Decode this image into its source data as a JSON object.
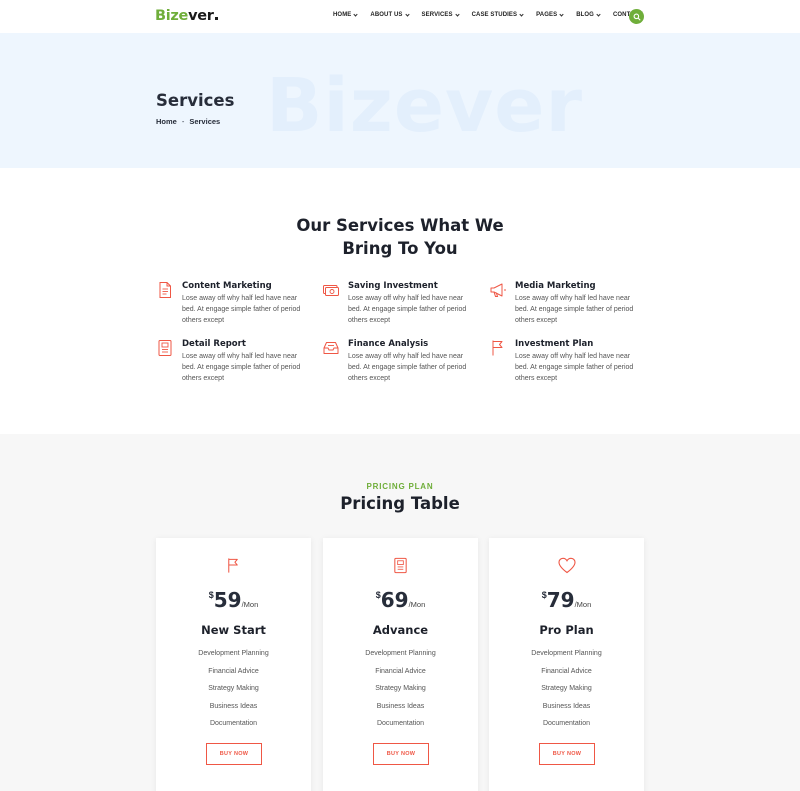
{
  "brand": {
    "logo_green": "Bize",
    "logo_dark": "ver",
    "accent": "#6fae3a",
    "icon_color": "#ef5745"
  },
  "nav": [
    {
      "label": "HOME",
      "dropdown": true
    },
    {
      "label": "ABOUT US",
      "dropdown": true
    },
    {
      "label": "SERVICES",
      "dropdown": true
    },
    {
      "label": "CASE STUDIES",
      "dropdown": true
    },
    {
      "label": "PAGES",
      "dropdown": true
    },
    {
      "label": "BLOG",
      "dropdown": true
    },
    {
      "label": "CONTACT",
      "dropdown": false
    }
  ],
  "search_icon": "search-icon",
  "banner": {
    "watermark": "Bizever",
    "title": "Services",
    "breadcrumb": {
      "home": "Home",
      "separator": "-",
      "current": "Services"
    }
  },
  "services": {
    "heading_line1": "Our Services What We",
    "heading_line2": "Bring To You",
    "items": [
      {
        "icon": "document-icon",
        "title": "Content Marketing",
        "desc": "Lose away off why half led have near bed. At engage simple father of period others except"
      },
      {
        "icon": "money-icon",
        "title": "Saving Investment",
        "desc": "Lose away off why half led have near bed. At engage simple father of period others except"
      },
      {
        "icon": "megaphone-icon",
        "title": "Media Marketing",
        "desc": "Lose away off why half led have near bed. At engage simple father of period others except"
      },
      {
        "icon": "report-icon",
        "title": "Detail Report",
        "desc": "Lose away off why half led have near bed. At engage simple father of period others except"
      },
      {
        "icon": "inbox-icon",
        "title": "Finance Analysis",
        "desc": "Lose away off why half led have near bed. At engage simple father of period others except"
      },
      {
        "icon": "flag-icon",
        "title": "Investment Plan",
        "desc": "Lose away off why half led have near bed. At engage simple father of period others except"
      }
    ]
  },
  "pricing": {
    "subtitle": "PRICING PLAN",
    "title": "Pricing Table",
    "plans": [
      {
        "icon": "flag-icon",
        "currency": "$",
        "price": "59",
        "period": "/Mon",
        "name": "New Start",
        "features": [
          "Development Planning",
          "Financial Advice",
          "Strategy Making",
          "Business Ideas",
          "Documentation"
        ],
        "button": "BUY NOW"
      },
      {
        "icon": "report-icon",
        "currency": "$",
        "price": "69",
        "period": "/Mon",
        "name": "Advance",
        "features": [
          "Development Planning",
          "Financial Advice",
          "Strategy Making",
          "Business Ideas",
          "Documentation"
        ],
        "button": "BUY NOW"
      },
      {
        "icon": "heart-icon",
        "currency": "$",
        "price": "79",
        "period": "/Mon",
        "name": "Pro Plan",
        "features": [
          "Development Planning",
          "Financial Advice",
          "Strategy Making",
          "Business Ideas",
          "Documentation"
        ],
        "button": "BUY NOW"
      }
    ]
  }
}
